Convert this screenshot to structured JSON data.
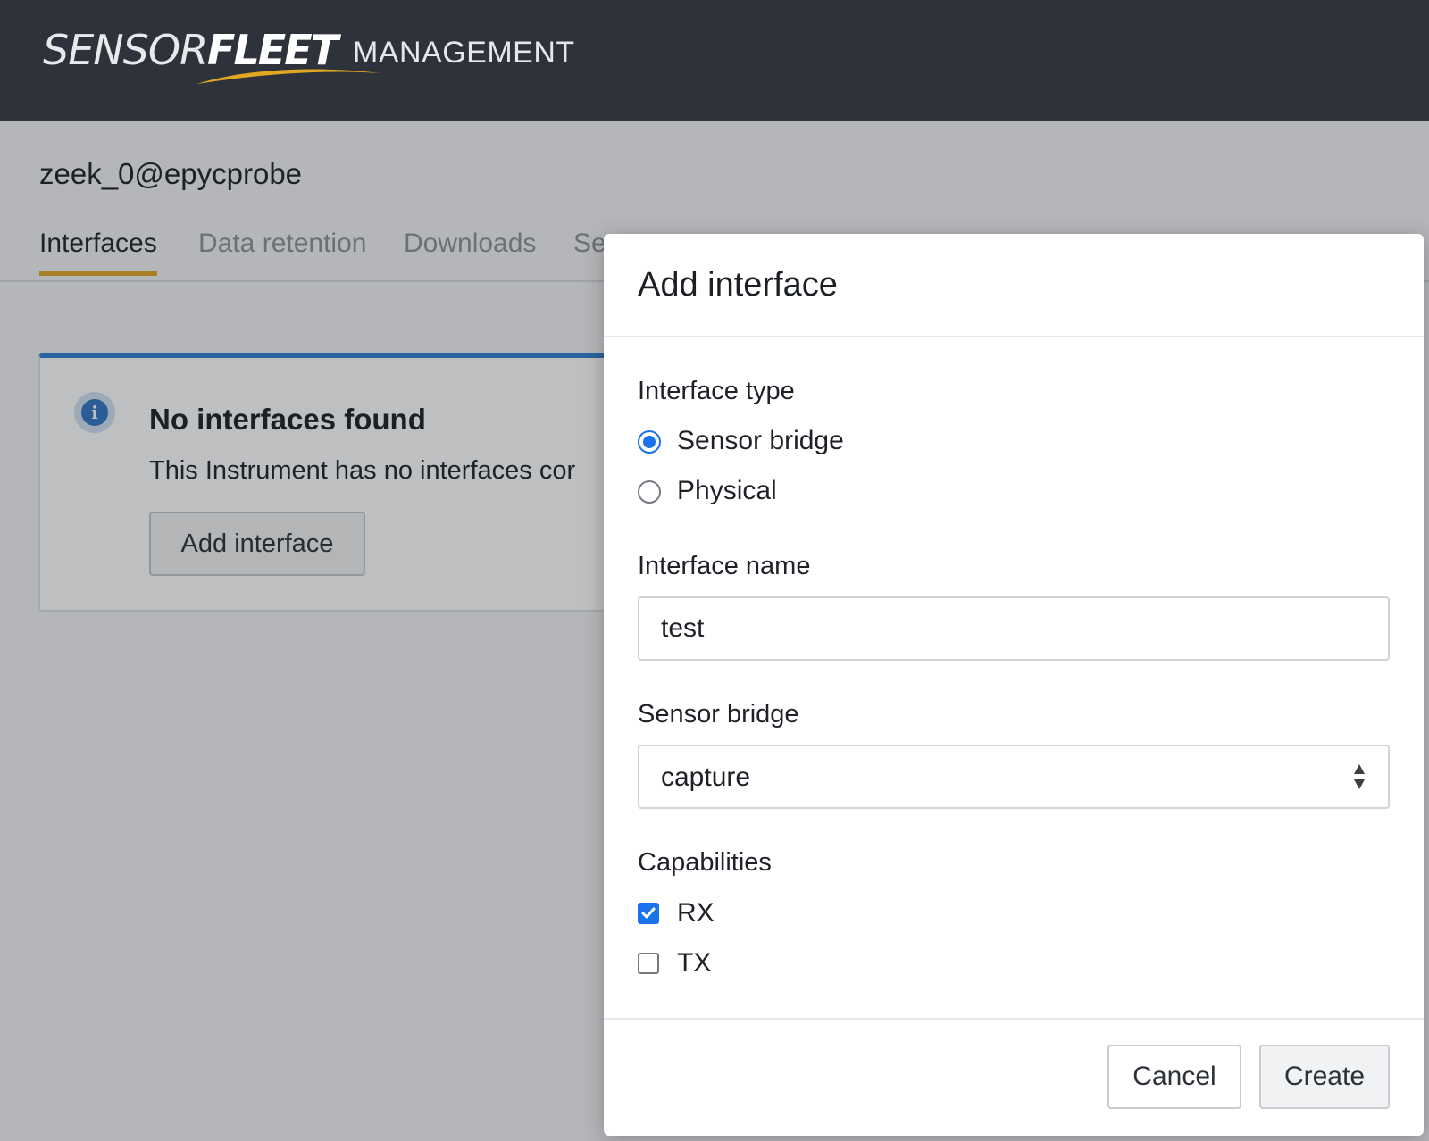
{
  "header": {
    "logo_part1": "SENSOR",
    "logo_part2": "FLEET",
    "logo_sub": "MANAGEMENT"
  },
  "instrument": {
    "title": "zeek_0@epycprobe"
  },
  "tabs": [
    {
      "label": "Interfaces",
      "active": true
    },
    {
      "label": "Data retention",
      "active": false
    },
    {
      "label": "Downloads",
      "active": false
    },
    {
      "label": "Se",
      "active": false
    }
  ],
  "notice": {
    "title": "No interfaces found",
    "text": "This Instrument has no interfaces cor",
    "button_label": "Add interface",
    "icon": "info-icon"
  },
  "modal": {
    "title": "Add interface",
    "interface_type": {
      "label": "Interface type",
      "options": [
        {
          "label": "Sensor bridge",
          "selected": true
        },
        {
          "label": "Physical",
          "selected": false
        }
      ]
    },
    "interface_name": {
      "label": "Interface name",
      "value": "test"
    },
    "sensor_bridge": {
      "label": "Sensor bridge",
      "value": "capture"
    },
    "capabilities": {
      "label": "Capabilities",
      "options": [
        {
          "label": "RX",
          "checked": true
        },
        {
          "label": "TX",
          "checked": false
        }
      ]
    },
    "cancel_label": "Cancel",
    "create_label": "Create"
  },
  "colors": {
    "topbar": "#2d323b",
    "accent_tab": "#e0a624",
    "info_blue": "#2f7fd0",
    "control_blue": "#1a73e8"
  }
}
